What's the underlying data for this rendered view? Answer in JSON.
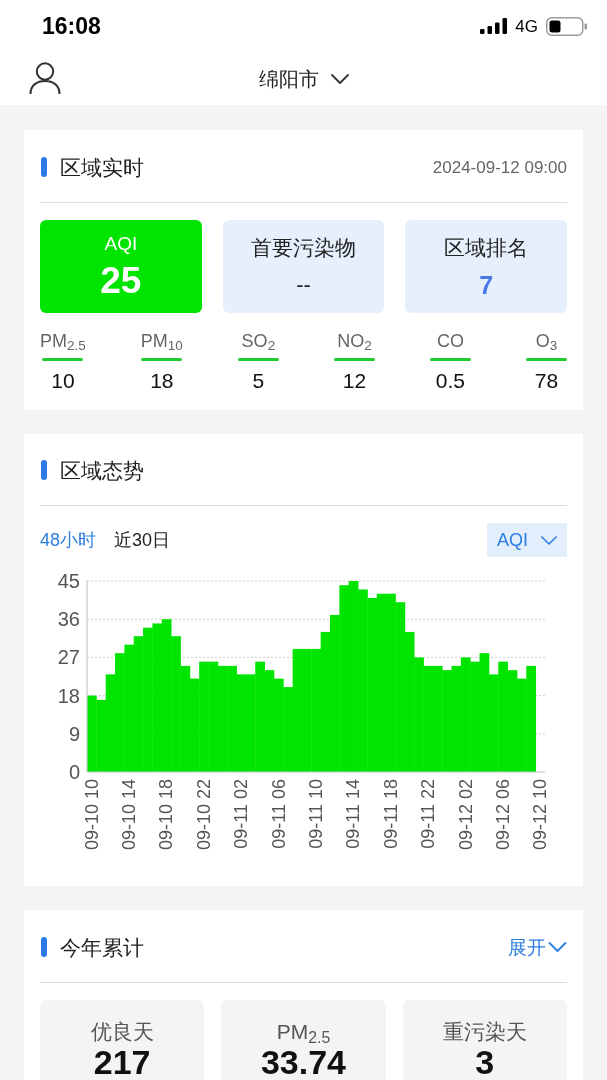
{
  "status_bar": {
    "time": "16:08",
    "network": "4G"
  },
  "header": {
    "city": "绵阳市"
  },
  "realtime": {
    "title": "区域实时",
    "timestamp": "2024-09-12 09:00",
    "tiles": [
      {
        "kind": "aqi",
        "label": "AQI",
        "value": "25"
      },
      {
        "kind": "info",
        "label": "首要污染物",
        "value": "--"
      },
      {
        "kind": "rank",
        "label": "区域排名",
        "value": "7"
      }
    ],
    "pollutants": [
      {
        "label": "PM$_{2.5}$",
        "value": "10"
      },
      {
        "label": "PM$_{10}$",
        "value": "18"
      },
      {
        "label": "SO$_{2}$",
        "value": "5"
      },
      {
        "label": "NO$_{2}$",
        "value": "12"
      },
      {
        "label": "CO",
        "value": "0.5"
      },
      {
        "label": "O$_{3}$",
        "value": "78"
      }
    ]
  },
  "trend": {
    "title": "区域态势",
    "tabs": [
      {
        "label": "48小时",
        "selected": true
      },
      {
        "label": "近30日",
        "selected": false
      }
    ],
    "metric_dropdown": "AQI",
    "chart_data": {
      "type": "bar",
      "grid": true,
      "categories": [
        "09-10 10",
        null,
        null,
        null,
        "09-10 14",
        null,
        null,
        null,
        "09-10 18",
        null,
        null,
        null,
        "09-10 22",
        null,
        null,
        null,
        "09-11 02",
        null,
        null,
        null,
        "09-11 06",
        null,
        null,
        null,
        "09-11 10",
        null,
        null,
        null,
        "09-11 14",
        null,
        null,
        null,
        "09-11 18",
        null,
        null,
        null,
        "09-11 22",
        null,
        null,
        null,
        "09-12 02",
        null,
        null,
        null,
        "09-12 06",
        null,
        null,
        null,
        "09-12 10"
      ],
      "values": [
        18,
        17,
        23,
        28,
        30,
        32,
        34,
        35,
        36,
        32,
        25,
        22,
        26,
        26,
        25,
        25,
        23,
        23,
        26,
        24,
        22,
        20,
        29,
        29,
        29,
        33,
        37,
        44,
        45,
        43,
        41,
        42,
        42,
        40,
        33,
        27,
        25,
        25,
        24,
        25,
        27,
        26,
        28,
        23,
        26,
        24,
        22,
        25,
        null
      ],
      "ylim": [
        0,
        45
      ],
      "yticks": [
        0,
        9,
        18,
        27,
        36,
        45
      ]
    }
  },
  "annual": {
    "title": "今年累计",
    "toggle": {
      "label": "展开",
      "expanded": false
    },
    "tiles": [
      {
        "label": "优良天",
        "value": "217"
      },
      {
        "label": "PM$_{2.5}$",
        "value": "33.74"
      },
      {
        "label": "重污染天",
        "value": "3"
      }
    ]
  }
}
